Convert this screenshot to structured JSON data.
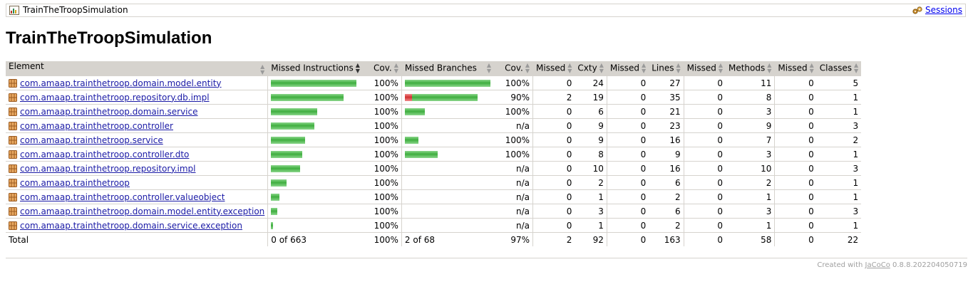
{
  "breadcrumb": {
    "report_title": "TrainTheTroopSimulation",
    "report_icon": "report-icon",
    "sessions_label": "Sessions",
    "sessions_icon": "session-icon"
  },
  "page_title": "TrainTheTroopSimulation",
  "table": {
    "headers": {
      "element": "Element",
      "missed_instructions": "Missed Instructions",
      "cov1": "Cov.",
      "missed_branches": "Missed Branches",
      "cov2": "Cov.",
      "missed_cxty": "Missed",
      "cxty": "Cxty",
      "missed_lines": "Missed",
      "lines": "Lines",
      "missed_methods": "Missed",
      "methods": "Methods",
      "missed_classes": "Missed",
      "classes": "Classes"
    },
    "rows": [
      {
        "name": "com.amaap.trainthetroop.domain.model.entity",
        "instr_cov": "100%",
        "instr_bar": 1.0,
        "branch_cov": "100%",
        "branch_green": 1.0,
        "branch_red": 0,
        "mcx": "0",
        "cx": "24",
        "ml": "0",
        "l": "27",
        "mm": "0",
        "m": "11",
        "mc": "0",
        "c": "5"
      },
      {
        "name": "com.amaap.trainthetroop.repository.db.impl",
        "instr_cov": "100%",
        "instr_bar": 0.85,
        "branch_cov": "90%",
        "branch_green": 0.77,
        "branch_red": 0.08,
        "mcx": "2",
        "cx": "19",
        "ml": "0",
        "l": "35",
        "mm": "0",
        "m": "8",
        "mc": "0",
        "c": "1"
      },
      {
        "name": "com.amaap.trainthetroop.domain.service",
        "instr_cov": "100%",
        "instr_bar": 0.54,
        "branch_cov": "100%",
        "branch_green": 0.23,
        "branch_red": 0,
        "mcx": "0",
        "cx": "6",
        "ml": "0",
        "l": "21",
        "mm": "0",
        "m": "3",
        "mc": "0",
        "c": "1"
      },
      {
        "name": "com.amaap.trainthetroop.controller",
        "instr_cov": "100%",
        "instr_bar": 0.51,
        "branch_cov": "n/a",
        "branch_green": 0,
        "branch_red": 0,
        "mcx": "0",
        "cx": "9",
        "ml": "0",
        "l": "23",
        "mm": "0",
        "m": "9",
        "mc": "0",
        "c": "3"
      },
      {
        "name": "com.amaap.trainthetroop.service",
        "instr_cov": "100%",
        "instr_bar": 0.4,
        "branch_cov": "100%",
        "branch_green": 0.16,
        "branch_red": 0,
        "mcx": "0",
        "cx": "9",
        "ml": "0",
        "l": "16",
        "mm": "0",
        "m": "7",
        "mc": "0",
        "c": "2"
      },
      {
        "name": "com.amaap.trainthetroop.controller.dto",
        "instr_cov": "100%",
        "instr_bar": 0.37,
        "branch_cov": "100%",
        "branch_green": 0.38,
        "branch_red": 0,
        "mcx": "0",
        "cx": "8",
        "ml": "0",
        "l": "9",
        "mm": "0",
        "m": "3",
        "mc": "0",
        "c": "1"
      },
      {
        "name": "com.amaap.trainthetroop.repository.impl",
        "instr_cov": "100%",
        "instr_bar": 0.34,
        "branch_cov": "n/a",
        "branch_green": 0,
        "branch_red": 0,
        "mcx": "0",
        "cx": "10",
        "ml": "0",
        "l": "16",
        "mm": "0",
        "m": "10",
        "mc": "0",
        "c": "3"
      },
      {
        "name": "com.amaap.trainthetroop",
        "instr_cov": "100%",
        "instr_bar": 0.18,
        "branch_cov": "n/a",
        "branch_green": 0,
        "branch_red": 0,
        "mcx": "0",
        "cx": "2",
        "ml": "0",
        "l": "6",
        "mm": "0",
        "m": "2",
        "mc": "0",
        "c": "1"
      },
      {
        "name": "com.amaap.trainthetroop.controller.valueobject",
        "instr_cov": "100%",
        "instr_bar": 0.1,
        "branch_cov": "n/a",
        "branch_green": 0,
        "branch_red": 0,
        "mcx": "0",
        "cx": "1",
        "ml": "0",
        "l": "2",
        "mm": "0",
        "m": "1",
        "mc": "0",
        "c": "1"
      },
      {
        "name": "com.amaap.trainthetroop.domain.model.entity.exception",
        "instr_cov": "100%",
        "instr_bar": 0.075,
        "branch_cov": "n/a",
        "branch_green": 0,
        "branch_red": 0,
        "mcx": "0",
        "cx": "3",
        "ml": "0",
        "l": "6",
        "mm": "0",
        "m": "3",
        "mc": "0",
        "c": "3"
      },
      {
        "name": "com.amaap.trainthetroop.domain.service.exception",
        "instr_cov": "100%",
        "instr_bar": 0.025,
        "branch_cov": "n/a",
        "branch_green": 0,
        "branch_red": 0,
        "mcx": "0",
        "cx": "1",
        "ml": "0",
        "l": "2",
        "mm": "0",
        "m": "1",
        "mc": "0",
        "c": "1"
      }
    ],
    "total": {
      "label": "Total",
      "instr": "0 of 663",
      "instr_cov": "100%",
      "branch": "2 of 68",
      "branch_cov": "97%",
      "mcx": "2",
      "cx": "92",
      "ml": "0",
      "l": "163",
      "mm": "0",
      "m": "58",
      "mc": "0",
      "c": "22"
    }
  },
  "footer": {
    "prefix": "Created with",
    "tool_link": "JaCoCo",
    "version": "0.8.8.202204050719"
  },
  "colors": {
    "covered": "#3fae3f",
    "missed": "#d03030",
    "header_bg": "#d6d3ce",
    "link": "#1a1aa6"
  }
}
